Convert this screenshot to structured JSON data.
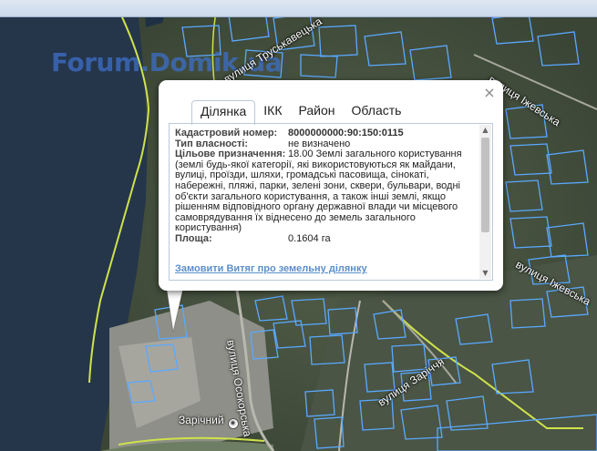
{
  "watermark": "Forum.Domik.ua",
  "streets": [
    {
      "name": "вулиця Труськавецька"
    },
    {
      "name": "вулиця Іжевська"
    },
    {
      "name": "вулиця Іжевська"
    },
    {
      "name": "вулиця Осокорська"
    },
    {
      "name": "вулиця Заріччя"
    }
  ],
  "poi": {
    "name": "Зарічний",
    "icon": "dot-pin-icon"
  },
  "popup": {
    "close_label": "×",
    "tabs": [
      {
        "label": "Ділянка",
        "active": true
      },
      {
        "label": "ІКК",
        "active": false
      },
      {
        "label": "Район",
        "active": false
      },
      {
        "label": "Область",
        "active": false
      }
    ],
    "fields": {
      "cadastral_label": "Кадастровий номер:",
      "cadastral_value": "8000000000:90:150:0115",
      "ownership_label": "Тип власності:",
      "ownership_value": "не визначено",
      "purpose_label": "Цільове призначення:",
      "purpose_value": "18.00 Землі загального користування",
      "purpose_desc": "(землі будь-якої категорії, які використовуються як майдани, вулиці, проїзди, шляхи, громадські пасовища, сінокаті, набережні, пляжі, парки, зелені зони, сквери, бульвари, водні об'єкти загального користування, а також інші землі, якщо рішенням відповідного органу державної влади чи місцевого самоврядування їх віднесено до земель загального користування)",
      "area_label": "Площа:",
      "area_value": "0.1604 га"
    },
    "order_link": "Замовити Витяг про земельну ділянку"
  },
  "colors": {
    "parcel_outline": "#5aa9ff",
    "district_line": "#cfe24a",
    "link": "#5a8fc9"
  }
}
